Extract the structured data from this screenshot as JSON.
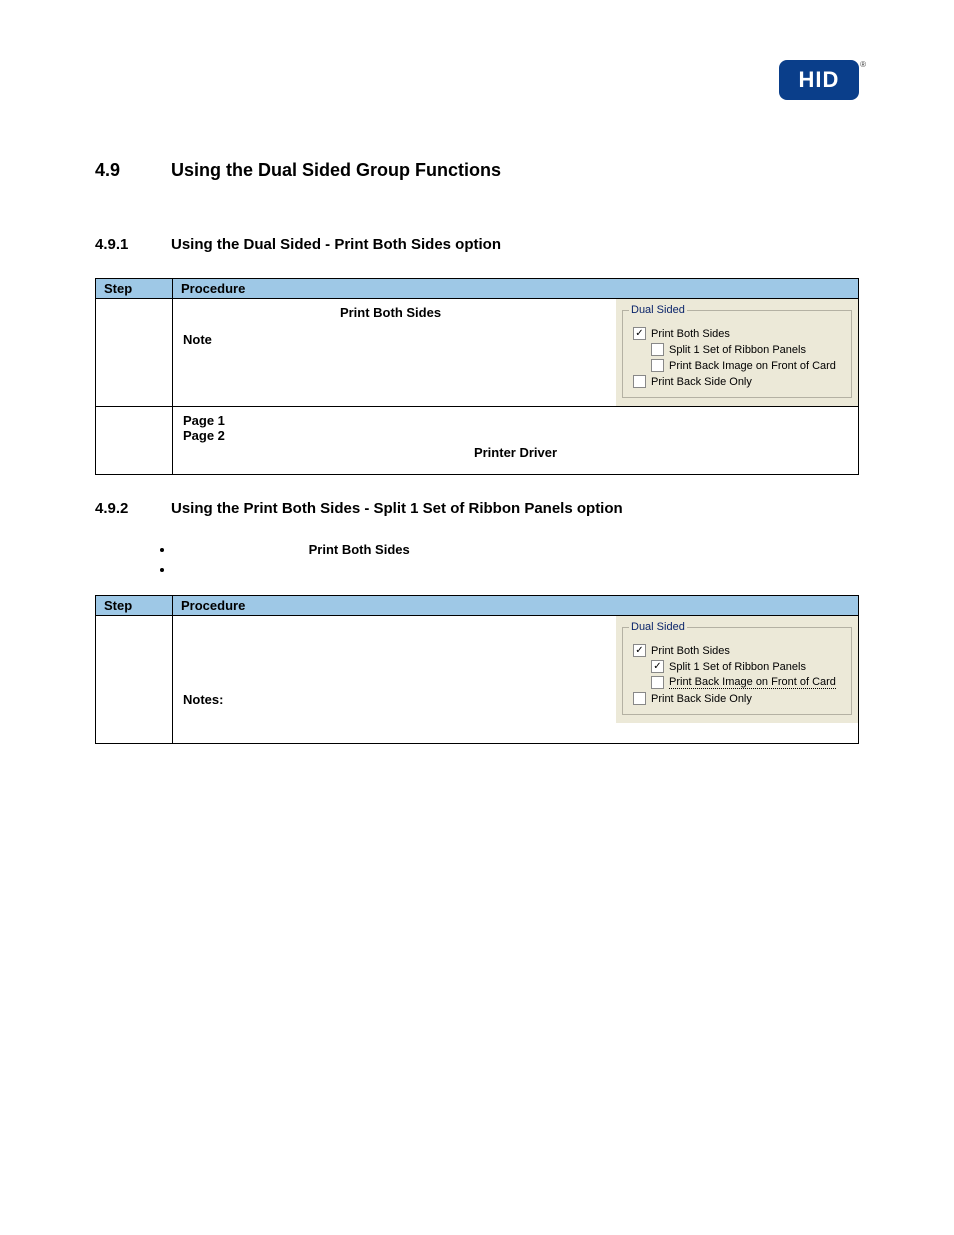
{
  "logo_text": "HID",
  "section": {
    "number": "4.9",
    "title": "Using the Dual Sided Group Functions"
  },
  "sub1": {
    "number": "4.9.1",
    "title": "Using the Dual Sided - Print Both Sides option",
    "headers": {
      "step": "Step",
      "procedure": "Procedure"
    },
    "row1": {
      "b1": "Print Both Sides",
      "b2": "Note"
    },
    "row2": {
      "b1": "Page 1",
      "b2": "Page 2",
      "b3": "Printer Driver"
    },
    "panel": {
      "legend": "Dual Sided",
      "opt1": "Print Both Sides",
      "opt2": "Split 1 Set of Ribbon Panels",
      "opt3": "Print Back Image on Front of Card",
      "opt4": "Print Back Side Only"
    }
  },
  "sub2": {
    "number": "4.9.2",
    "title": "Using the Print Both Sides - Split 1 Set of Ribbon Panels option",
    "bullet1": "Print Both Sides",
    "headers": {
      "step": "Step",
      "procedure": "Procedure"
    },
    "row1": {
      "b1": "Notes:"
    },
    "panel": {
      "legend": "Dual Sided",
      "opt1": "Print Both Sides",
      "opt2": "Split 1 Set of Ribbon Panels",
      "opt3": "Print Back Image on Front of Card",
      "opt4": "Print Back Side Only"
    }
  }
}
